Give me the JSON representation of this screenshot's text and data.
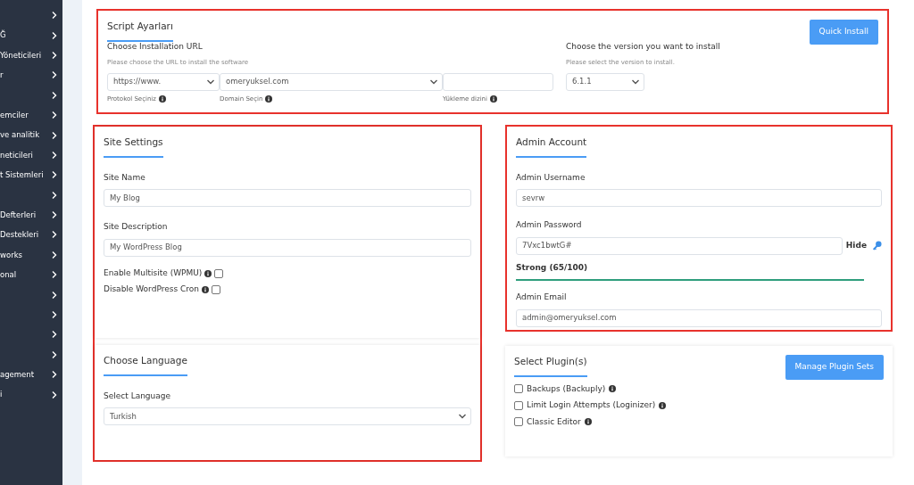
{
  "sidebar": {
    "items": [
      {
        "kind": "icon"
      },
      {
        "kind": "text",
        "label": "Ğ"
      },
      {
        "kind": "text",
        "label": "Yöneticileri"
      },
      {
        "kind": "text",
        "label": "r"
      },
      {
        "kind": "icon"
      },
      {
        "kind": "text",
        "label": "emciler"
      },
      {
        "kind": "text",
        "label": "ve analitik"
      },
      {
        "kind": "text",
        "label": "neticileri"
      },
      {
        "kind": "text",
        "label": "t Sistemleri"
      },
      {
        "kind": "icon"
      },
      {
        "kind": "text",
        "label": "Defterleri"
      },
      {
        "kind": "text",
        "label": "Destekleri"
      },
      {
        "kind": "text",
        "label": "works"
      },
      {
        "kind": "text",
        "label": "onal"
      },
      {
        "kind": "icon"
      },
      {
        "kind": "icon"
      },
      {
        "kind": "icon"
      },
      {
        "kind": "icon"
      },
      {
        "kind": "text",
        "label": "agement"
      },
      {
        "kind": "text",
        "label": "i"
      }
    ]
  },
  "script_settings": {
    "title": "Script Ayarları",
    "button": "Quick Install",
    "url": {
      "label": "Choose Installation URL",
      "help": "Please choose the URL to install the software",
      "protocol": "https://www.",
      "protocol_hint": "Protokol Seçiniz",
      "domain": "omeryuksel.com",
      "domain_hint": "Domain Seçin",
      "directory_hint": "Yükleme dizini"
    },
    "version": {
      "label": "Choose the version you want to install",
      "help": "Please select the version to install.",
      "value": "6.1.1"
    }
  },
  "site_settings": {
    "title": "Site Settings",
    "fields": [
      {
        "label": "Site Name",
        "value": "My Blog"
      },
      {
        "label": "Site Description",
        "value": "My WordPress Blog"
      }
    ],
    "options": [
      {
        "label": "Enable Multisite (WPMU)",
        "checked": false
      },
      {
        "label": "Disable WordPress Cron",
        "checked": false
      }
    ]
  },
  "admin_account": {
    "title": "Admin Account",
    "username_label": "Admin Username",
    "username": "sevrw",
    "password_label": "Admin Password",
    "password": "7Vxc1bwtG#",
    "hide": "Hide",
    "strength": "Strong (65/100)",
    "strength_bar": {
      "level": 1
    },
    "email_label": "Admin Email",
    "email": "admin@omeryuksel.com"
  },
  "language": {
    "title": "Choose Language",
    "label": "Select Language",
    "value": "Turkish"
  },
  "plugins": {
    "title": "Select Plugin(s)",
    "button": "Manage Plugin Sets",
    "items": [
      {
        "label": "Backups (Backuply)",
        "checked": false
      },
      {
        "label": "Limit Login Attempts (Loginizer)",
        "checked": false
      },
      {
        "label": "Classic Editor",
        "checked": false
      }
    ]
  }
}
